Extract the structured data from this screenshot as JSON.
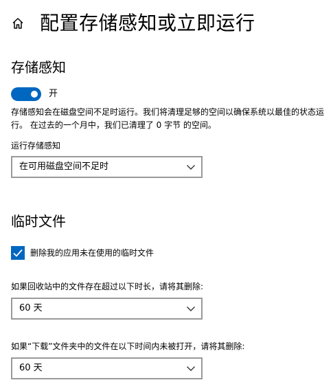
{
  "header": {
    "title": "配置存储感知或立即运行",
    "home_icon": "home-icon"
  },
  "storage_sense": {
    "section_title": "存储感知",
    "toggle": {
      "state": "on",
      "label": "开",
      "color": "#0067c0"
    },
    "description": "存储感知会在磁盘空间不足时运行。我们将清理足够的空间以确保系统以最佳的状态运行。 在过去的一个月中，我们已清理了 0 字节 的空间。",
    "run_label": "运行存储感知",
    "run_value": "在可用磁盘空间不足时"
  },
  "temp_files": {
    "section_title": "临时文件",
    "checkbox": {
      "checked": true,
      "label": "删除我的应用未在使用的临时文件"
    },
    "recycle_label": "如果回收站中的文件存在超过以下时长，请将其删除:",
    "recycle_value": "60 天",
    "downloads_label": "如果“下载”文件夹中的文件在以下时间内未被打开，请将其删除:",
    "downloads_value": "60 天"
  },
  "colors": {
    "accent": "#0067c0",
    "dropdown_border": "#999999"
  }
}
